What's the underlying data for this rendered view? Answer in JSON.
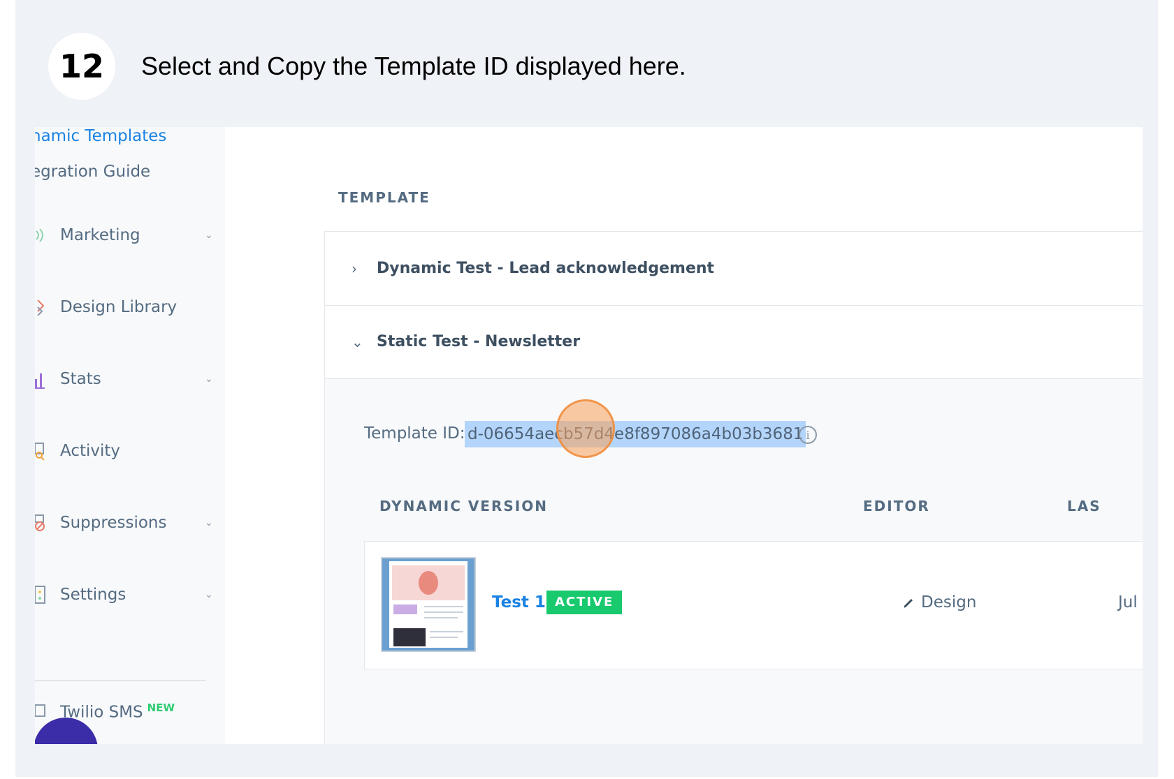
{
  "tutorial": {
    "step_number": "12",
    "instruction": "Select and Copy the Template ID displayed here."
  },
  "sidebar": {
    "active_link": "namic Templates",
    "secondary_link": "egration Guide",
    "items": [
      {
        "label": "Marketing",
        "icon": "megaphone-icon",
        "has_chevron": true
      },
      {
        "label": "Design Library",
        "icon": "design-library-icon",
        "has_chevron": false
      },
      {
        "label": "Stats",
        "icon": "stats-bar-icon",
        "has_chevron": true
      },
      {
        "label": "Activity",
        "icon": "activity-search-icon",
        "has_chevron": false
      },
      {
        "label": "Suppressions",
        "icon": "suppressions-icon",
        "has_chevron": true
      },
      {
        "label": "Settings",
        "icon": "settings-icon",
        "has_chevron": true
      }
    ],
    "sms_label": "Twilio SMS",
    "sms_badge": "NEW"
  },
  "main": {
    "section_title": "TEMPLATE",
    "templates": [
      {
        "name": "Dynamic Test - Lead acknowledgement",
        "expanded": false
      },
      {
        "name": "Static Test - Newsletter",
        "expanded": true
      }
    ],
    "template_id_label": "Template ID:",
    "template_id_value": "d-06654aecb57d4e8f897086a4b03b3681",
    "columns": {
      "version": "DYNAMIC VERSION",
      "editor": "EDITOR",
      "last": "LAS"
    },
    "version": {
      "name": "Test 1",
      "status": "ACTIVE",
      "editor": "Design",
      "date": "Jul"
    }
  },
  "colors": {
    "accent_blue": "#1a82e2",
    "active_green": "#18c96e",
    "selection_highlight": "#b4d5fb",
    "text_slate": "#546b81",
    "background": "#eff2f7"
  }
}
